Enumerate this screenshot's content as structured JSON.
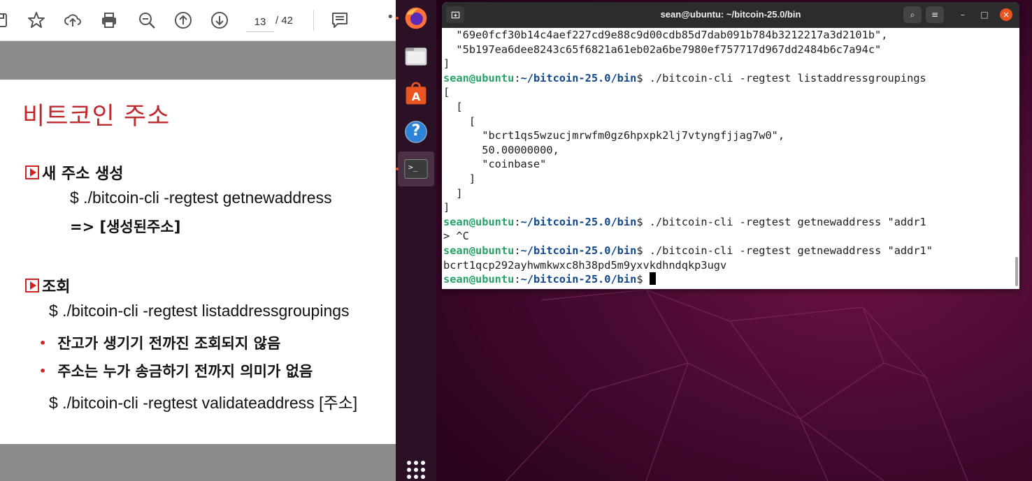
{
  "pdf_viewer": {
    "page_current": "13",
    "page_separator": "/ 42",
    "icons": [
      "save-icon",
      "star-icon",
      "upload-icon",
      "print-icon",
      "zoom-out-icon",
      "page-up-icon",
      "page-down-icon",
      "comment-icon",
      "more-icon"
    ],
    "slide": {
      "title": "비트코인 주소",
      "section1_heading": "새 주소 생성",
      "section1_cmd": "$ ./bitcoin-cli   -regtest  getnewaddress",
      "section1_result": "=> [생성된주소]",
      "section2_heading": "조회",
      "section2_cmd": "$ ./bitcoin-cli   -regtest  listaddressgroupings",
      "bullet1": "잔고가 생기기 전까진 조회되지 않음",
      "bullet2": "주소는 누가 송금하기 전까지 의미가 없음",
      "section2_cmd2": "$ ./bitcoin-cli   -regtest  validateaddress [주소]",
      "bullet_marker": "•"
    }
  },
  "dock": {
    "apps": [
      "firefox-icon",
      "files-icon",
      "software-icon",
      "help-icon",
      "terminal-icon"
    ],
    "help_glyph": "?",
    "terminal_glyph": ">_"
  },
  "terminal": {
    "title": "sean@ubuntu: ~/bitcoin-25.0/bin",
    "prompt_user": "sean@ubuntu",
    "prompt_sep": ":",
    "prompt_path": "~/bitcoin-25.0/bin",
    "prompt_dollar": "$ ",
    "lines": [
      {
        "type": "out",
        "text": "  \"69e0fcf30b14c4aef227cd9e88c9d00cdb85d7dab091b784b3212217a3d2101b\","
      },
      {
        "type": "out",
        "text": "  \"5b197ea6dee8243c65f6821a61eb02a6be7980ef757717d967dd2484b6c7a94c\""
      },
      {
        "type": "out",
        "text": "]"
      },
      {
        "type": "cmd",
        "text": "./bitcoin-cli -regtest listaddressgroupings"
      },
      {
        "type": "out",
        "text": "["
      },
      {
        "type": "out",
        "text": "  ["
      },
      {
        "type": "out",
        "text": "    ["
      },
      {
        "type": "out",
        "text": "      \"bcrt1qs5wzucjmrwfm0gz6hpxpk2lj7vtyngfjjag7w0\","
      },
      {
        "type": "out",
        "text": "      50.00000000,"
      },
      {
        "type": "out",
        "text": "      \"coinbase\""
      },
      {
        "type": "out",
        "text": "    ]"
      },
      {
        "type": "out",
        "text": "  ]"
      },
      {
        "type": "out",
        "text": "]"
      },
      {
        "type": "cmd",
        "text": "./bitcoin-cli -regtest getnewaddress \"addr1"
      },
      {
        "type": "out",
        "text": "> ^C"
      },
      {
        "type": "cmd",
        "text": "./bitcoin-cli -regtest getnewaddress \"addr1\""
      },
      {
        "type": "out",
        "text": "bcrt1qcp292ayhwmkwxc8h38pd5m9yxvkdhndqkp3ugv"
      },
      {
        "type": "cmd",
        "text": "",
        "cursor": true
      }
    ],
    "header_buttons": [
      "new-tab-icon",
      "search-icon",
      "menu-icon",
      "minimize-icon",
      "maximize-icon",
      "close-icon"
    ],
    "button_glyphs": {
      "search": "⌕",
      "menu": "≡",
      "minimize": "–",
      "maximize": "□",
      "close": "×"
    }
  }
}
